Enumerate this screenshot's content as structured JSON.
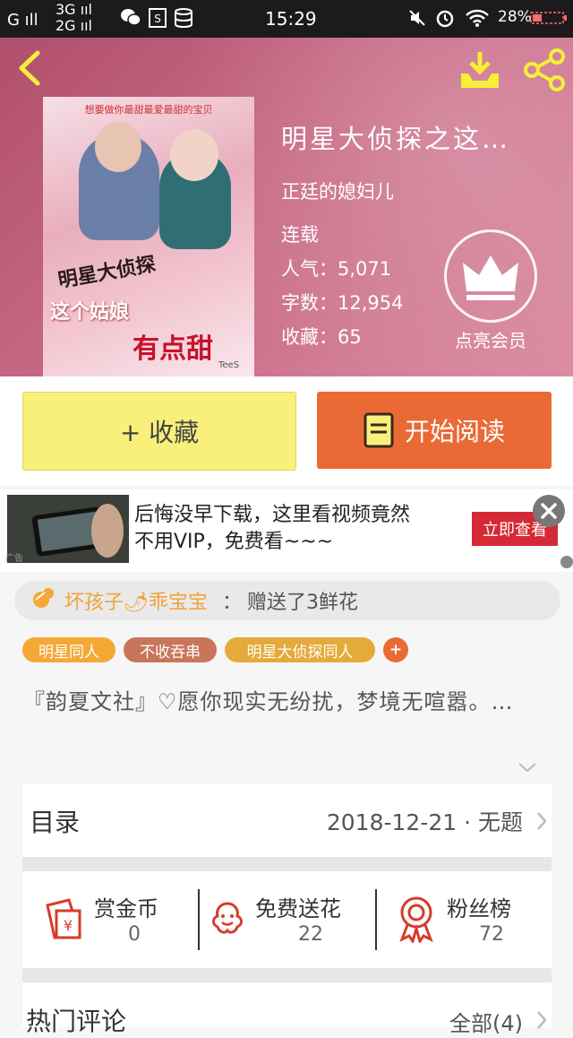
{
  "status_bar": {
    "signal1": "G ıll",
    "network": "3G ııl",
    "network2": "2G ııl",
    "time": "15:29",
    "battery": "28%"
  },
  "book": {
    "cover_tagline": "想要做你最甜最爱最甜的宝贝",
    "cover_title_1": "明星大侦探",
    "cover_title_2": "这个姑娘",
    "cover_title_3": "有点甜",
    "cover_credit": "TeeS",
    "title": "明星大侦探之这…",
    "author": "正廷的媳妇儿",
    "status": "连载",
    "popularity": "人气：5,071",
    "word_count": "字数：12,954",
    "collects": "收藏：65",
    "vip_label": "点亮会员"
  },
  "actions": {
    "favorite": "+ 收藏",
    "read": "开始阅读"
  },
  "ad": {
    "text_line1": "后悔没早下载，这里看视频竟然",
    "text_line2": "不用VIP，免费看~~~",
    "button": "立即查看",
    "badge": "广告"
  },
  "gift": {
    "user": "坏孩子🌶乖宝宝",
    "sep": "：",
    "message": "赠送了3鲜花"
  },
  "tags": [
    {
      "label": "明星同人",
      "color": "#f5a835"
    },
    {
      "label": "不收吞串",
      "color": "#c9755a"
    },
    {
      "label": "明星大侦探同人",
      "color": "#e4aa3a"
    },
    {
      "label": "+",
      "color": "#ea6a35"
    }
  ],
  "intro": "『韵夏文社』♡愿你现实无纷扰，梦境无喧嚣。…",
  "catalog": {
    "label": "目录",
    "latest": "2018-12-21 · 无题"
  },
  "stats": [
    {
      "label": "赏金币",
      "value": "0"
    },
    {
      "label": "免费送花",
      "value": "22"
    },
    {
      "label": "粉丝榜",
      "value": "72"
    }
  ],
  "comments": {
    "label": "热门评论",
    "all": "全部(4)"
  },
  "colors": {
    "accent_orange": "#ea6a35",
    "favorite_yellow": "#f9ef7b",
    "icon_red": "#d63b2a"
  }
}
